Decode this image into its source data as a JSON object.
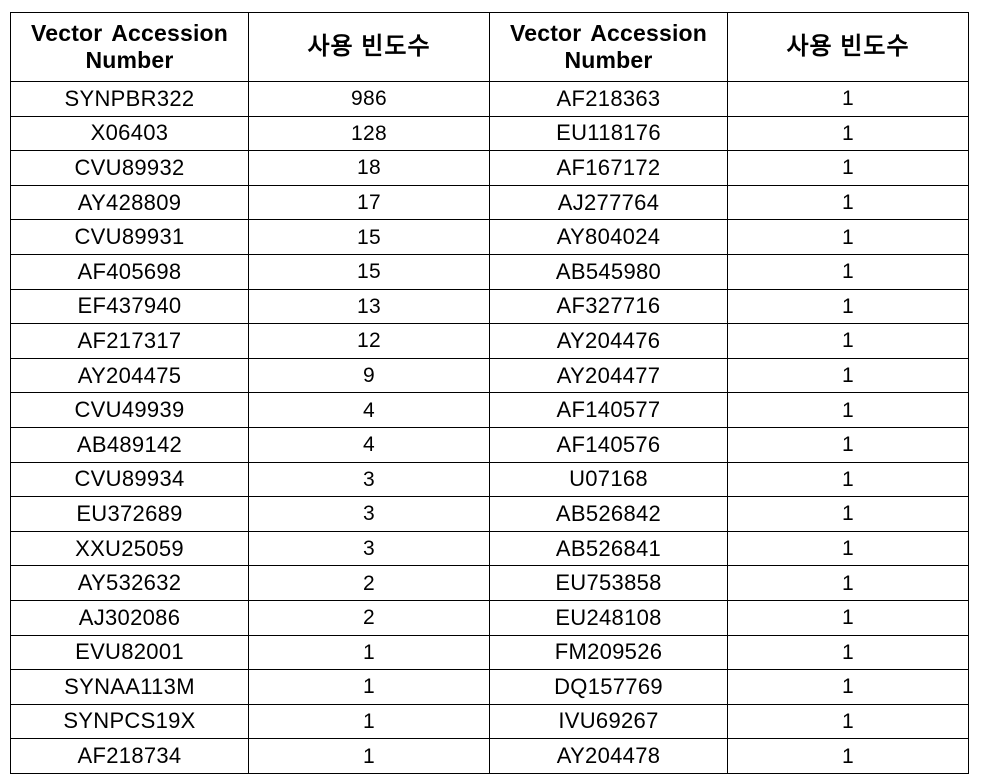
{
  "table": {
    "headers": {
      "accession": "Vector  Accession\nNumber",
      "accession_line1": "Vector  Accession",
      "accession_line2": "Number",
      "frequency": "사용 빈도수"
    },
    "columns": [
      "Vector Accession Number",
      "사용 빈도수",
      "Vector Accession Number",
      "사용 빈도수"
    ],
    "row_count": 20,
    "rows": [
      {
        "accession_left": "SYNPBR322",
        "frequency_left": "986",
        "accession_right": "AF218363",
        "frequency_right": "1"
      },
      {
        "accession_left": "X06403",
        "frequency_left": "128",
        "accession_right": "EU118176",
        "frequency_right": "1"
      },
      {
        "accession_left": "CVU89932",
        "frequency_left": "18",
        "accession_right": "AF167172",
        "frequency_right": "1"
      },
      {
        "accession_left": "AY428809",
        "frequency_left": "17",
        "accession_right": "AJ277764",
        "frequency_right": "1"
      },
      {
        "accession_left": "CVU89931",
        "frequency_left": "15",
        "accession_right": "AY804024",
        "frequency_right": "1"
      },
      {
        "accession_left": "AF405698",
        "frequency_left": "15",
        "accession_right": "AB545980",
        "frequency_right": "1"
      },
      {
        "accession_left": "EF437940",
        "frequency_left": "13",
        "accession_right": "AF327716",
        "frequency_right": "1"
      },
      {
        "accession_left": "AF217317",
        "frequency_left": "12",
        "accession_right": "AY204476",
        "frequency_right": "1"
      },
      {
        "accession_left": "AY204475",
        "frequency_left": "9",
        "accession_right": "AY204477",
        "frequency_right": "1"
      },
      {
        "accession_left": "CVU49939",
        "frequency_left": "4",
        "accession_right": "AF140577",
        "frequency_right": "1"
      },
      {
        "accession_left": "AB489142",
        "frequency_left": "4",
        "accession_right": "AF140576",
        "frequency_right": "1"
      },
      {
        "accession_left": "CVU89934",
        "frequency_left": "3",
        "accession_right": "U07168",
        "frequency_right": "1"
      },
      {
        "accession_left": "EU372689",
        "frequency_left": "3",
        "accession_right": "AB526842",
        "frequency_right": "1"
      },
      {
        "accession_left": "XXU25059",
        "frequency_left": "3",
        "accession_right": "AB526841",
        "frequency_right": "1"
      },
      {
        "accession_left": "AY532632",
        "frequency_left": "2",
        "accession_right": "EU753858",
        "frequency_right": "1"
      },
      {
        "accession_left": "AJ302086",
        "frequency_left": "2",
        "accession_right": "EU248108",
        "frequency_right": "1"
      },
      {
        "accession_left": "EVU82001",
        "frequency_left": "1",
        "accession_right": "FM209526",
        "frequency_right": "1"
      },
      {
        "accession_left": "SYNAA113M",
        "frequency_left": "1",
        "accession_right": "DQ157769",
        "frequency_right": "1"
      },
      {
        "accession_left": "SYNPCS19X",
        "frequency_left": "1",
        "accession_right": "IVU69267",
        "frequency_right": "1"
      },
      {
        "accession_left": "AF218734",
        "frequency_left": "1",
        "accession_right": "AY204478",
        "frequency_right": "1"
      }
    ]
  },
  "colors": {
    "background": "#ffffff",
    "text": "#000000",
    "border": "#000000"
  }
}
